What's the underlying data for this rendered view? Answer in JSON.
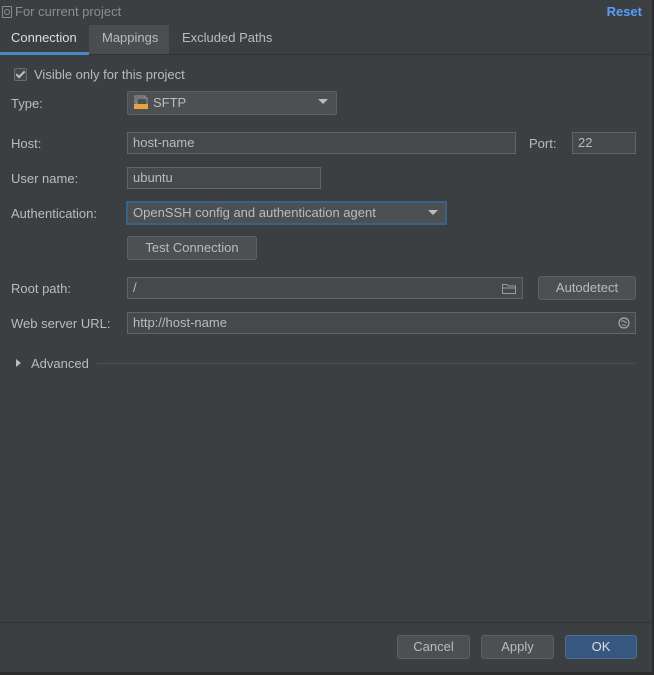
{
  "header": {
    "scope_label": "For current project",
    "reset_label": "Reset"
  },
  "tabs": [
    {
      "label": "Connection"
    },
    {
      "label": "Mappings"
    },
    {
      "label": "Excluded Paths"
    }
  ],
  "visible_only": {
    "label": "Visible only for this project",
    "checked": true
  },
  "type": {
    "label": "Type:",
    "value": "SFTP",
    "icon": "sftp-icon"
  },
  "host": {
    "label": "Host:",
    "value": "host-name"
  },
  "port": {
    "label": "Port:",
    "value": "22"
  },
  "username": {
    "label": "User name:",
    "value": "ubuntu"
  },
  "auth": {
    "label": "Authentication:",
    "value": "OpenSSH config and authentication agent"
  },
  "test_connection_label": "Test Connection",
  "root_path": {
    "label": "Root path:",
    "value": "/",
    "icon": "folder-icon"
  },
  "autodetect_label": "Autodetect",
  "web_url": {
    "label": "Web server URL:",
    "value": "http://host-name",
    "icon": "globe-icon"
  },
  "advanced_label": "Advanced",
  "footer": {
    "cancel_label": "Cancel",
    "apply_label": "Apply",
    "ok_label": "OK"
  },
  "colors": {
    "background": "#3c3f41",
    "accent": "#4a88c7",
    "link": "#589df6",
    "primary_button": "#365880"
  }
}
